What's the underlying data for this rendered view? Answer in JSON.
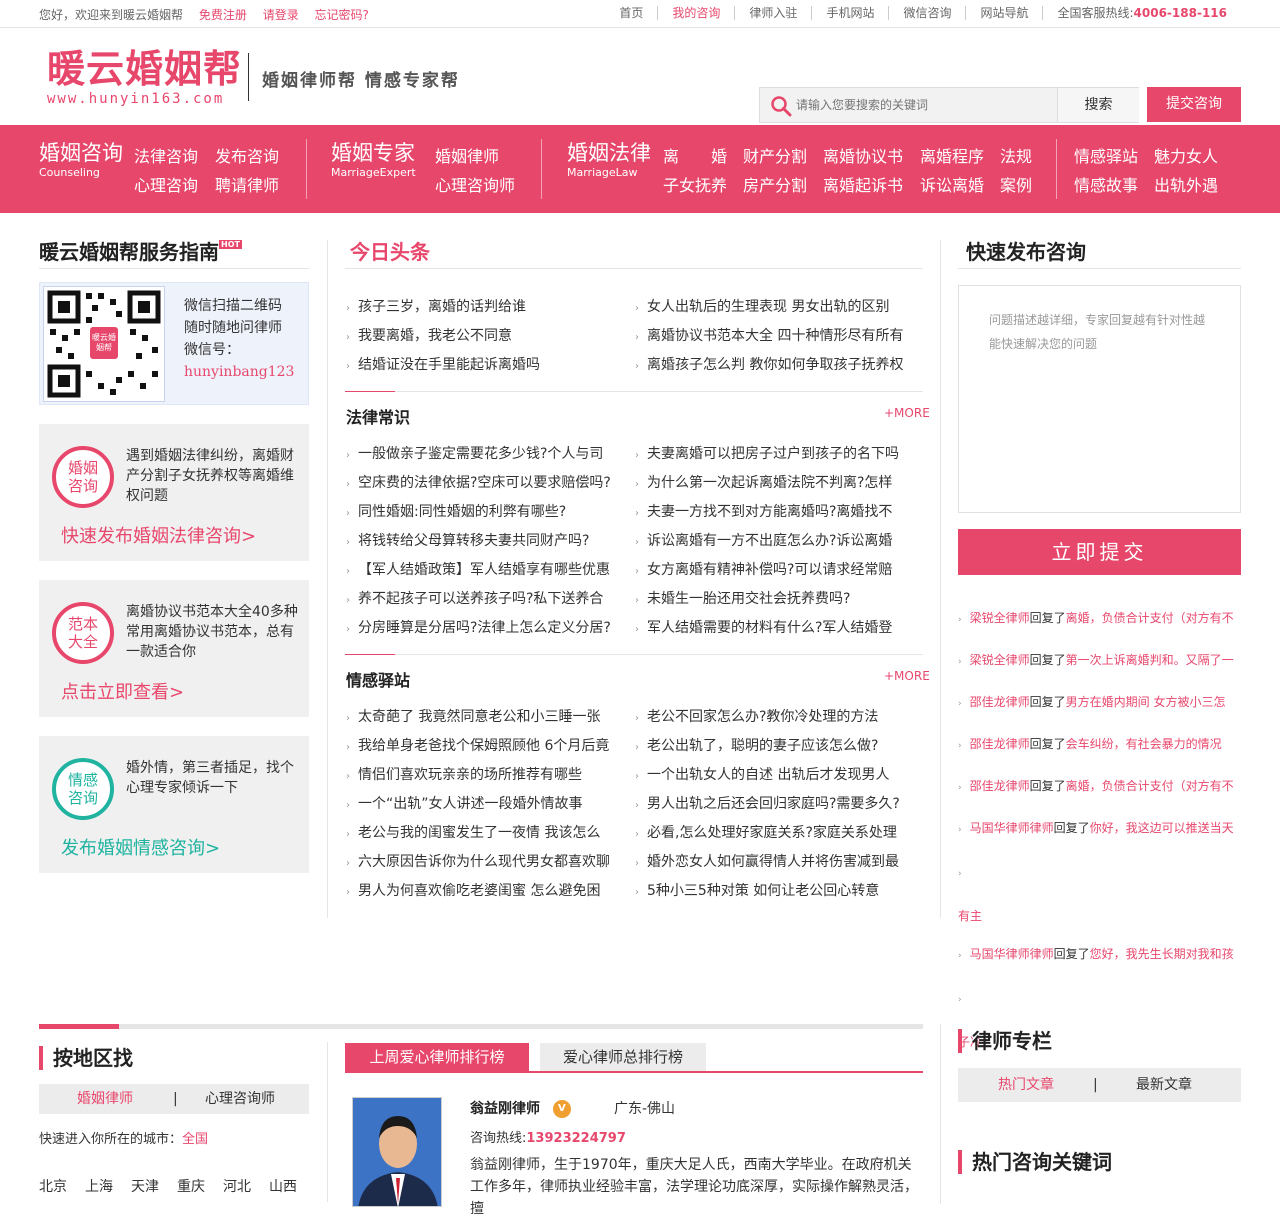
{
  "topbar": {
    "welcome": "您好，欢迎来到暖云婚姻帮",
    "register": "免费注册",
    "login": "请登录",
    "forgot": "忘记密码?",
    "links": [
      "首页",
      "我的咨询",
      "律师入驻",
      "手机网站",
      "微信咨询",
      "网站导航"
    ],
    "hotline_label": "全国客服热线:",
    "hotline": "4006-188-116"
  },
  "header": {
    "logo_cn": "暖云婚姻帮",
    "logo_en": "www.hunyin163.com",
    "slogan": "婚姻律师帮 情感专家帮",
    "search_placeholder": "请输入您要搜索的关键词",
    "search_button": "搜索",
    "submit_button": "提交咨询"
  },
  "nav": {
    "groups": [
      {
        "title": "婚姻咨询",
        "sub": "Counseling",
        "items": [
          "法律咨询",
          "发布咨询",
          "心理咨询",
          "聘请律师"
        ]
      },
      {
        "title": "婚姻专家",
        "sub": "MarriageExpert",
        "items": [
          "婚姻律师",
          "心理咨询师"
        ]
      },
      {
        "title": "婚姻法律",
        "sub": "MarriageLaw",
        "items": [
          "离　　婚",
          "财产分割",
          "离婚协议书",
          "离婚程序",
          "法规",
          "子女抚养",
          "房产分割",
          "离婚起诉书",
          "诉讼离婚",
          "案例"
        ]
      },
      {
        "title": "",
        "sub": "",
        "items": [
          "情感驿站",
          "魅力女人",
          "情感故事",
          "出轨外遇"
        ]
      }
    ]
  },
  "left": {
    "title": "暖云婚姻帮服务指南",
    "hot": "HOT",
    "qr_lines": [
      "微信扫描二维码",
      "随时随地问律师",
      "微信号："
    ],
    "qr_id": "hunyinbang123",
    "qr_logo": "暖云婚姻帮",
    "cards": [
      {
        "circle": "婚姻\n咨询",
        "desc": "遇到婚姻法律纠纷，离婚财产分割子女抚养权等离婚维权问题",
        "link": "快速发布婚姻法律咨询>"
      },
      {
        "circle": "范本\n大全",
        "desc": "离婚协议书范本大全40多种常用离婚协议书范本，总有一款适合你",
        "link": "点击立即查看>"
      },
      {
        "circle": "情感\n咨询",
        "desc": "婚外情，第三者插足，找个心理专家倾诉一下",
        "link": "发布婚姻情感咨询>"
      }
    ]
  },
  "center": {
    "headline_title": "今日头条",
    "headlines": [
      [
        "孩子三岁，离婚的话判给谁",
        "女人出轨后的生理表现 男女出轨的区别"
      ],
      [
        "我要离婚，我老公不同意",
        "离婚协议书范本大全 四十种情形尽有所有"
      ],
      [
        "结婚证没在手里能起诉离婚吗",
        "离婚孩子怎么判 教你如何争取孩子抚养权"
      ]
    ],
    "law_title": "法律常识",
    "more": "+MORE",
    "law": [
      [
        "一般做亲子鉴定需要花多少钱?个人与司",
        "夫妻离婚可以把房子过户到孩子的名下吗"
      ],
      [
        "空床费的法律依据?空床可以要求赔偿吗?",
        "为什么第一次起诉离婚法院不判离?怎样"
      ],
      [
        "同性婚姻:同性婚姻的利弊有哪些?",
        "夫妻一方找不到对方能离婚吗?离婚找不"
      ],
      [
        "将钱转给父母算转移夫妻共同财产吗?",
        "诉讼离婚有一方不出庭怎么办?诉讼离婚"
      ],
      [
        "【军人结婚政策】军人结婚享有哪些优惠",
        "女方离婚有精神补偿吗?可以请求经常赔"
      ],
      [
        "养不起孩子可以送养孩子吗?私下送养合",
        "未婚生一胎还用交社会抚养费吗?"
      ],
      [
        "分房睡算是分居吗?法律上怎么定义分居?",
        "军人结婚需要的材料有什么?军人结婚登"
      ]
    ],
    "emotion_title": "情感驿站",
    "emotion": [
      [
        "太奇葩了 我竟然同意老公和小三睡一张",
        "老公不回家怎么办?教你冷处理的方法"
      ],
      [
        "我给单身老爸找个保姆照顾他 6个月后竟",
        "老公出轨了，聪明的妻子应该怎么做?"
      ],
      [
        "情侣们喜欢玩亲亲的场所推荐有哪些",
        "一个出轨女人的自述 出轨后才发现男人"
      ],
      [
        "一个“出轨”女人讲述一段婚外情故事",
        "男人出轨之后还会回归家庭吗?需要多久?"
      ],
      [
        "老公与我的闺蜜发生了一夜情 我该怎么",
        "必看,怎么处理好家庭关系?家庭关系处理"
      ],
      [
        "六大原因告诉你为什么现代男女都喜欢聊",
        "婚外恋女人如何赢得情人并将伤害减到最"
      ],
      [
        "男人为何喜欢偷吃老婆闺蜜 怎么避免困",
        "5种小三5种对策 如何让老公回心转意"
      ]
    ]
  },
  "right": {
    "title": "快速发布咨询",
    "textarea_placeholder": "问题描述越详细，专家回复越有针对性越能快速解决您的问题",
    "submit": "立即提交",
    "replies": [
      {
        "who": "梁锐全律师",
        "verb": "回复了",
        "what": "离婚，负债合计支付（对方有不"
      },
      {
        "who": "梁锐全律师",
        "verb": "回复了",
        "what": "第一次上诉离婚判和。又隔了一"
      },
      {
        "who": "邵佳龙律师",
        "verb": "回复了",
        "what": "男方在婚内期间 女方被小三怎"
      },
      {
        "who": "邵佳龙律师",
        "verb": "回复了",
        "what": "会车纠纷，有社会暴力的情况"
      },
      {
        "who": "邵佳龙律师",
        "verb": "回复了",
        "what": "离婚，负债合计支付（对方有不"
      },
      {
        "who": "马国华律师律师",
        "verb": "回复了",
        "what": "你好，我这边可以推送当天",
        "tail": "有主"
      },
      {
        "who": "马国华律师律师",
        "verb": "回复了",
        "what": "您好，我先生长期对我和孩",
        "tail": "子冷"
      }
    ]
  },
  "bottom": {
    "region_title": "按地区找",
    "region_tabs": [
      "婚姻律师",
      "心理咨询师"
    ],
    "city_label": "快速进入你所在的城市：",
    "city_all": "全国",
    "cities": [
      "北京",
      "上海",
      "天津",
      "重庆",
      "河北",
      "山西"
    ],
    "rank_tabs": [
      "上周爱心律师排行榜",
      "爱心律师总排行榜"
    ],
    "lawyer": {
      "name": "翁益刚律师",
      "badge": "V",
      "location": "广东-佛山",
      "hotline_label": "咨询热线:",
      "hotline": "13923224797",
      "desc": "翁益刚律师，生于1970年，重庆大足人氏，西南大学毕业。在政府机关工作多年，律师执业经验丰富，法学理论功底深厚，实际操作解熟灵活，擅"
    },
    "column_title": "律师专栏",
    "column_tabs": [
      "热门文章",
      "最新文章"
    ],
    "keywords_title": "热门咨询关键词"
  },
  "colors": {
    "accent": "#e8476c",
    "teal": "#1fb3a0"
  }
}
